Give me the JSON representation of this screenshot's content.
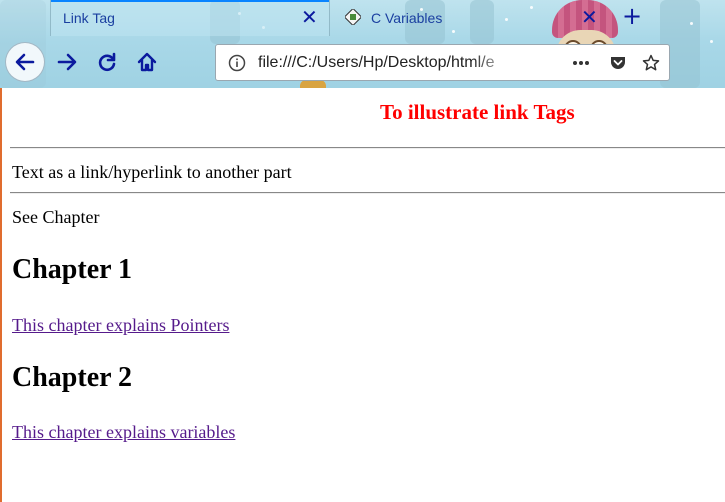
{
  "tabs": [
    {
      "title": "Link Tag",
      "active": true
    },
    {
      "title": "C Variables",
      "active": false
    }
  ],
  "toolbar": {
    "url": "file:///C:/Users/Hp/Desktop/html/e"
  },
  "colors": {
    "heading": "#ff0000",
    "visited_link": "#551a8b",
    "toolbar_icon": "#0b1a9e",
    "active_tab_indicator": "#0a84ff"
  },
  "page": {
    "heading": "To illustrate link Tags",
    "intro": "Text as a link/hyperlink to another part",
    "see_chapter": "See Chapter",
    "chapters": [
      {
        "title": "Chapter 1",
        "link": "This chapter explains Pointers"
      },
      {
        "title": "Chapter 2",
        "link": "This chapter explains variables"
      }
    ]
  }
}
